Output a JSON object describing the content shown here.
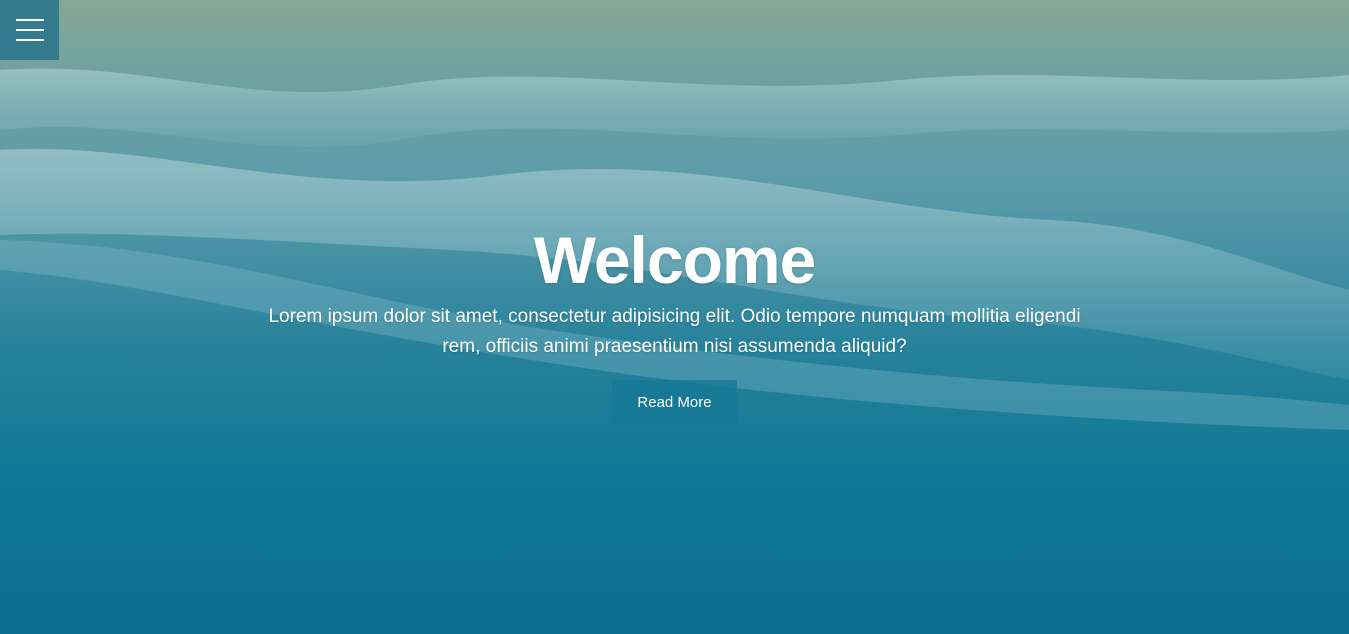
{
  "nav": {
    "menu_icon": "hamburger-menu-icon"
  },
  "hero": {
    "title": "Welcome",
    "subtitle": "Lorem ipsum dolor sit amet, consectetur adipisicing elit. Odio tempore numquam mollitia eligendi rem, officiis animi praesentium nisi assumenda aliquid?",
    "button_label": "Read More"
  },
  "colors": {
    "overlay": "#137a92",
    "text": "#ffffff",
    "button_bg": "#14789a"
  }
}
